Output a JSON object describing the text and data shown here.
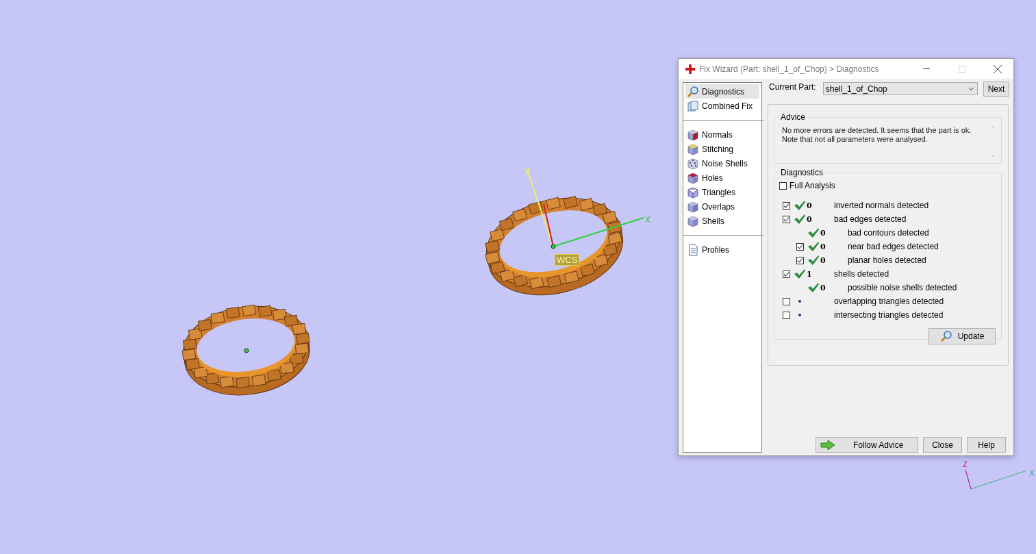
{
  "viewport": {
    "labels": [
      {
        "kind": "y-axis",
        "text": "Y"
      },
      {
        "kind": "x-axis",
        "text": "X"
      },
      {
        "kind": "wcs",
        "text": "WCS"
      },
      {
        "kind": "triad-z",
        "text": "Z"
      },
      {
        "kind": "triad-x",
        "text": "X"
      }
    ]
  },
  "window": {
    "title": "Fix Wizard (Part: shell_1_of_Chop) > Diagnostics"
  },
  "sidebar": {
    "groups": [
      [
        {
          "label": "Diagnostics",
          "selected": true
        },
        {
          "label": "Combined Fix",
          "selected": false
        }
      ],
      [
        {
          "label": "Normals",
          "selected": false
        },
        {
          "label": "Stitching",
          "selected": false
        },
        {
          "label": "Noise Shells",
          "selected": false
        },
        {
          "label": "Holes",
          "selected": false
        },
        {
          "label": "Triangles",
          "selected": false
        },
        {
          "label": "Overlaps",
          "selected": false
        },
        {
          "label": "Shells",
          "selected": false
        }
      ],
      [
        {
          "label": "Profiles",
          "selected": false
        }
      ]
    ]
  },
  "current_part": {
    "label": "Current Part:",
    "value": "shell_1_of_Chop",
    "next": "Next"
  },
  "advice": {
    "title": "Advice",
    "text": "No more errors are detected. It seems that the part is ok.\nNote that not all parameters were analysed."
  },
  "diagnostics": {
    "title": "Diagnostics",
    "full_analysis": {
      "label": "Full Analysis",
      "checked": false
    },
    "rows": [
      {
        "kind": "checkbox",
        "checked": true,
        "passed": true,
        "count": "0",
        "label": "inverted normals detected"
      },
      {
        "kind": "checkbox",
        "checked": true,
        "passed": true,
        "count": "0",
        "label": "bad edges detected",
        "children": [
          {
            "kind": "plain",
            "passed": true,
            "count": "0",
            "label": "bad contours detected"
          },
          {
            "kind": "checkbox",
            "checked": true,
            "passed": true,
            "count": "0",
            "label": "near bad edges detected"
          },
          {
            "kind": "checkbox",
            "checked": true,
            "passed": true,
            "count": "0",
            "label": "planar holes detected"
          }
        ]
      },
      {
        "kind": "checkbox",
        "checked": true,
        "passed": true,
        "count": "1",
        "label": "shells detected",
        "children": [
          {
            "kind": "plain",
            "passed": true,
            "count": "0",
            "label": "possible noise shells detected"
          }
        ]
      },
      {
        "kind": "checkbox",
        "checked": false,
        "passed": false,
        "label": "overlapping triangles detected"
      },
      {
        "kind": "checkbox",
        "checked": false,
        "passed": false,
        "label": "intersecting triangles detected"
      }
    ],
    "update": "Update"
  },
  "buttons": [
    {
      "kind": "primary",
      "label": "Follow Advice"
    },
    {
      "kind": "plain",
      "label": "Close"
    },
    {
      "kind": "plain",
      "label": "Help"
    }
  ]
}
